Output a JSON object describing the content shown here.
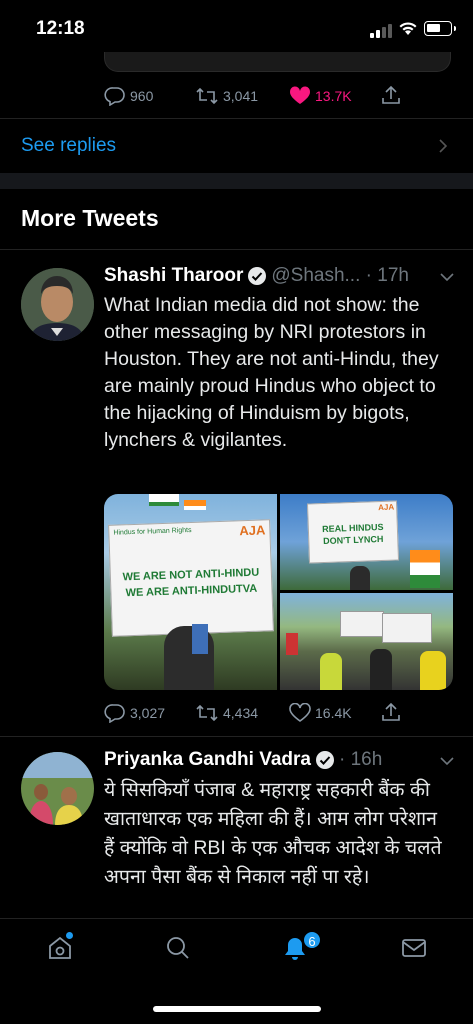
{
  "status_bar": {
    "time": "12:18"
  },
  "prev_tweet": {
    "replies": "960",
    "retweets": "3,041",
    "likes": "13.7K"
  },
  "see_replies": "See replies",
  "section_title": "More Tweets",
  "tweets": [
    {
      "name": "Shashi Tharoor",
      "handle": "@Shash...",
      "time": "17h",
      "text": "What Indian media did not show: the other messaging by NRI protestors in Houston. They are not anti-Hindu, they are mainly proud Hindus who object to the hijacking of Hinduism by bigots, lynchers & vigilantes.",
      "media": {
        "sign1_line1": "WE ARE NOT ANTI-HINDU",
        "sign1_line2": "WE ARE ANTI-HINDUTVA",
        "sign1_org": "Hindus for Human Rights",
        "sign2_line1": "REAL HINDUS",
        "sign2_line2": "DON'T LYNCH",
        "logo": "AJA"
      },
      "replies": "3,027",
      "retweets": "4,434",
      "likes": "16.4K"
    },
    {
      "name": "Priyanka Gandhi Vadra",
      "time": "16h",
      "text": "ये सिसकियाँ पंजाब & महाराष्ट्र सहकारी बैंक की खाताधारक एक महिला की हैं। आम लोग परेशान हैं क्योंकि वो RBI के एक औचक आदेश के चलते अपना पैसा बैंक से निकाल नहीं पा रहे।"
    }
  ],
  "tab_bar": {
    "notification_count": "6"
  },
  "colors": {
    "accent": "#1d9bf0",
    "like": "#f91880",
    "muted": "#8b98a5"
  }
}
